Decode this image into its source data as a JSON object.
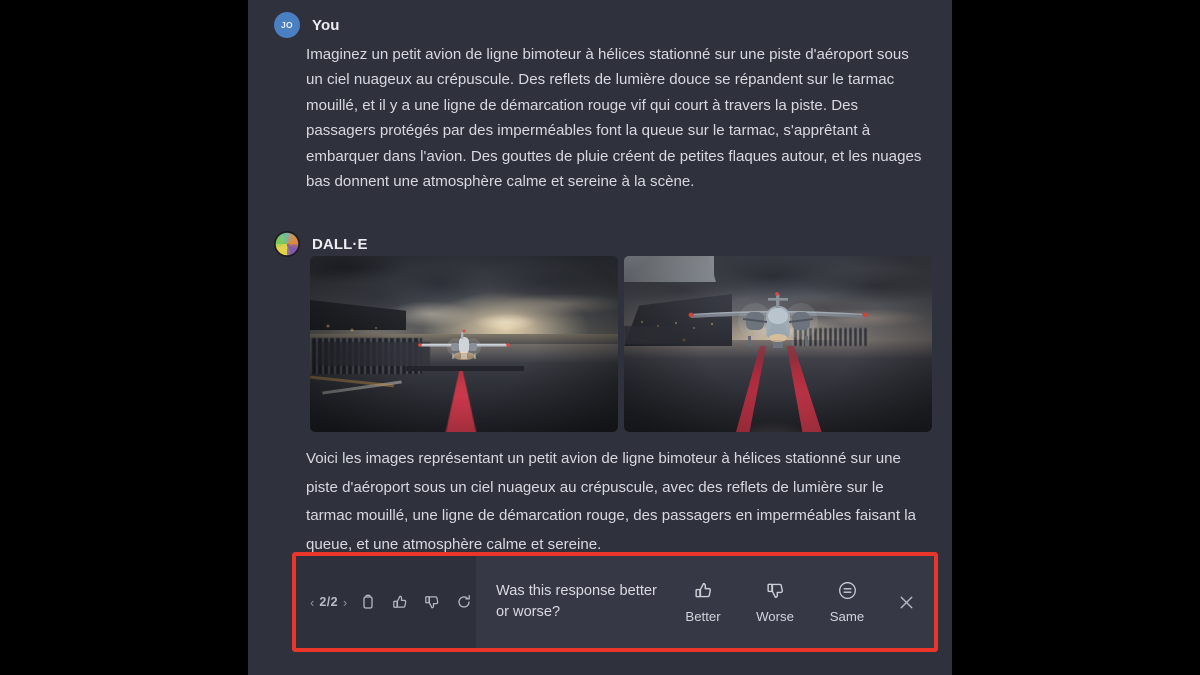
{
  "conversation": {
    "user": {
      "avatar_initials": "JO",
      "avatar_color": "#4a7fc1",
      "sender_name": "You",
      "message": "Imaginez un petit avion de ligne bimoteur à hélices stationné sur une piste d'aéroport sous un ciel nuageux au crépuscule. Des reflets de lumière douce se répandent sur le tarmac mouillé, et il y a une ligne de démarcation rouge vif qui court à travers la piste. Des passagers protégés par des imperméables font la queue sur le tarmac, s'apprêtant à embarquer dans l'avion. Des gouttes de pluie créent de petites flaques autour, et les nuages bas donnent une atmosphère calme et sereine à la scène."
    },
    "assistant": {
      "avatar_icon": "dalle-color-wheel-icon",
      "sender_name": "DALL·E",
      "images": [
        {
          "alt": "Twin-propeller airliner on wet tarmac at dusk with red stripe and queueing passengers"
        },
        {
          "alt": "Twin-propeller airliner head-on with terminal building, dual red stripes on wet runway"
        }
      ],
      "message": "Voici les images représentant un petit avion de ligne bimoteur à hélices stationné sur une piste d'aéroport sous un ciel nuageux au crépuscule, avec des reflets de lumière sur le tarmac mouillé, une ligne de démarcation rouge, des passagers en imperméables faisant la queue, et une atmosphère calme et sereine."
    }
  },
  "feedback_bar": {
    "highlight_color": "#e8372a",
    "pagination": {
      "prev_label": "‹",
      "count_label": "2/2",
      "next_label": "›"
    },
    "actions": [
      {
        "name": "copy-icon",
        "title": "Copy"
      },
      {
        "name": "thumbs-up-icon",
        "title": "Good response"
      },
      {
        "name": "thumbs-down-icon",
        "title": "Bad response"
      },
      {
        "name": "regenerate-icon",
        "title": "Regenerate"
      }
    ],
    "question": "Was this response better or worse?",
    "ratings": [
      {
        "icon": "thumbs-up-icon",
        "label": "Better"
      },
      {
        "icon": "thumbs-down-icon",
        "label": "Worse"
      },
      {
        "icon": "equals-circle-icon",
        "label": "Same"
      }
    ],
    "close_label": "✕"
  }
}
